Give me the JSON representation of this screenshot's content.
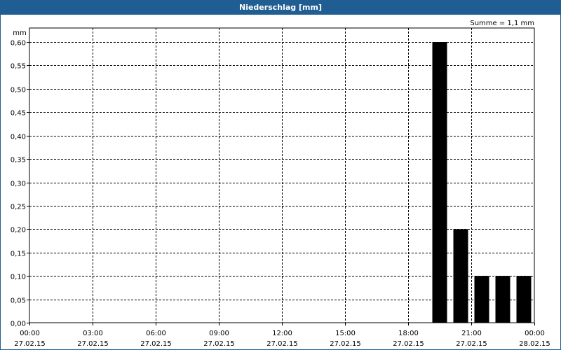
{
  "window": {
    "title": "Niederschlag [mm]"
  },
  "chart_data": {
    "type": "bar",
    "title": "Niederschlag [mm]",
    "ylabel": "mm",
    "summary": "Summe = 1,1 mm",
    "ylim": [
      0,
      0.63
    ],
    "yticks": [
      0,
      0.05,
      0.1,
      0.15,
      0.2,
      0.25,
      0.3,
      0.35,
      0.4,
      0.45,
      0.5,
      0.55,
      0.6
    ],
    "ytick_labels": [
      "0,00",
      "0,05",
      "0,10",
      "0,15",
      "0,20",
      "0,25",
      "0,30",
      "0,35",
      "0,40",
      "0,45",
      "0,50",
      "0,55",
      "0,60"
    ],
    "xlim_hours": [
      0,
      24
    ],
    "xtick_hours": [
      0,
      3,
      6,
      9,
      12,
      15,
      18,
      21,
      24
    ],
    "xtick_labels": [
      {
        "time": "00:00",
        "date": "27.02.15"
      },
      {
        "time": "03:00",
        "date": "27.02.15"
      },
      {
        "time": "06:00",
        "date": "27.02.15"
      },
      {
        "time": "09:00",
        "date": "27.02.15"
      },
      {
        "time": "12:00",
        "date": "27.02.15"
      },
      {
        "time": "15:00",
        "date": "27.02.15"
      },
      {
        "time": "18:00",
        "date": "27.02.15"
      },
      {
        "time": "21:00",
        "date": "27.02.15"
      },
      {
        "time": "00:00",
        "date": "28.02.15"
      }
    ],
    "bars": [
      {
        "time": "20:00",
        "hour": 20,
        "value": 0.6
      },
      {
        "time": "21:00",
        "hour": 21,
        "value": 0.2
      },
      {
        "time": "22:00",
        "hour": 22,
        "value": 0.1
      },
      {
        "time": "23:00",
        "hour": 23,
        "value": 0.1
      },
      {
        "time": "00:00",
        "hour": 24,
        "value": 0.1
      }
    ],
    "grid": true,
    "bar_color": "#000000"
  }
}
